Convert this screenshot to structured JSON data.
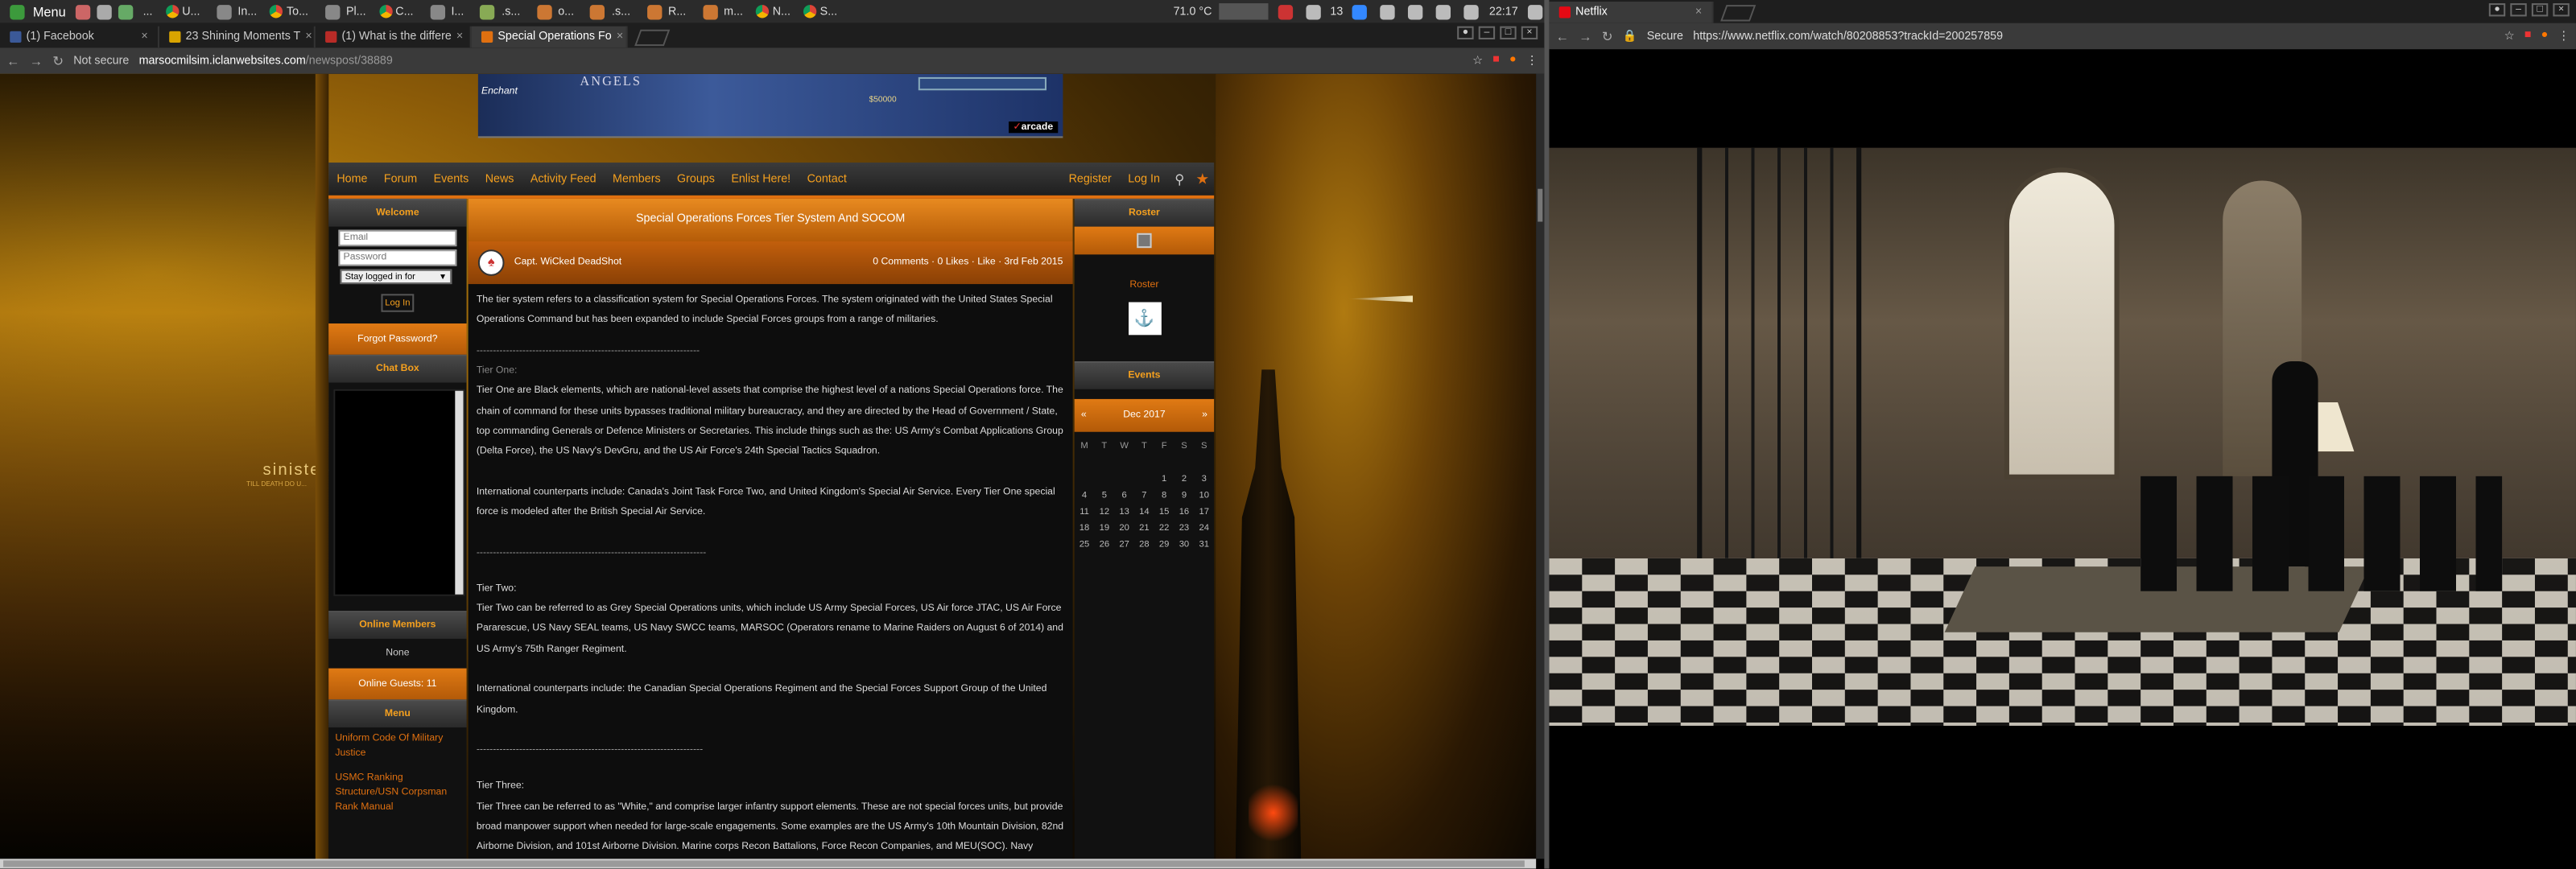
{
  "taskbar": {
    "menu_label": "Menu",
    "tasks": [
      {
        "label": "U..."
      },
      {
        "label": "In..."
      },
      {
        "label": "To..."
      },
      {
        "label": "Pl..."
      },
      {
        "label": "C..."
      },
      {
        "label": "I..."
      },
      {
        "label": ".s..."
      },
      {
        "label": "o..."
      },
      {
        "label": ".s..."
      },
      {
        "label": "R..."
      },
      {
        "label": "m..."
      },
      {
        "label": "N..."
      },
      {
        "label": "S..."
      }
    ],
    "temperature": "71.0 °C",
    "tray_count": "13",
    "clock": "22:17"
  },
  "left_browser": {
    "tabs": [
      {
        "title": "(1) Facebook",
        "color": "#3b5998"
      },
      {
        "title": "23 Shining Moments T",
        "color": "#d9a400"
      },
      {
        "title": "(1) What is the differe",
        "color": "#b92b27"
      },
      {
        "title": "Special Operations Fo",
        "color": "#e07010"
      }
    ],
    "security_label": "Not secure",
    "url_host": "marsocmilsim.iclanwebsites.com",
    "url_path": "/newspost/38889"
  },
  "site": {
    "ad": {
      "title": "ANGELS",
      "subtitle": "Enchant",
      "price": "$50000",
      "brand_prefix": "✓",
      "brand": "arcade"
    },
    "nav": [
      "Home",
      "Forum",
      "Events",
      "News",
      "Activity Feed",
      "Members",
      "Groups",
      "Enlist Here!",
      "Contact"
    ],
    "register": "Register",
    "login": "Log In",
    "branding": "sinisterd",
    "branding_sub": "TILL DEATH DO U...",
    "left": {
      "welcome": "Welcome",
      "email_placeholder": "Email",
      "password_placeholder": "Password",
      "stay_logged": "Stay logged in for",
      "login_button": "Log In",
      "forgot": "Forgot Password?",
      "chatbox": "Chat Box",
      "online_members": "Online Members",
      "none": "None",
      "online_guests": "Online Guests: 11",
      "menu": "Menu",
      "menu_items": [
        "Uniform Code Of Military Justice",
        "USMC Ranking Structure/USN Corpsman Rank Manual"
      ]
    },
    "post": {
      "title": "Special Operations Forces Tier System And SOCOM",
      "author": "Capt. WiCked DeadShot",
      "stats": "0 Comments · 0 Likes · Like · 3rd Feb 2015",
      "intro": "The tier system refers to a classification system for Special Operations Forces. The system originated with the United States Special Operations Command but has been expanded to include Special Forces groups from a range of militaries.",
      "rule1": "--------------------------------------------------------------------",
      "tier1_heading": "Tier One:",
      "tier1_text": "Tier One are Black elements, which are national-level assets that comprise the highest level of a nations Special Operations force. The chain of command for these units bypasses traditional military bureaucracy, and they are directed by the Head of Government / State, top commanding Generals or Defence Ministers or Secretaries. This include things such as the: US Army's Combat Applications Group (Delta Force), the US Navy's DevGru, and the US Air Force's 24th Special Tactics Squadron.",
      "tier1_intl": "International counterparts include: Canada's Joint Task Force Two, and United Kingdom's Special Air Service. Every Tier One special force is modeled after the British Special Air Service.",
      "rule2": "----------------------------------------------------------------------",
      "tier2_heading": "Tier Two:",
      "tier2_text": "Tier Two can be referred to as Grey Special Operations units, which include US Army Special Forces, US Air force JTAC, US Air Force Pararescue, US Navy SEAL teams, US Navy SWCC teams, MARSOC (Operators rename to Marine Raiders on August 6 of 2014) and US Army's 75th Ranger Regiment.",
      "tier2_intl": "International counterparts include: the Canadian Special Operations Regiment and the Special Forces Support Group of the United Kingdom.",
      "rule3": "---------------------------------------------------------------------",
      "tier3_heading": "Tier Three:",
      "tier3_text": "Tier Three can be referred to as \"White,\" and comprise larger infantry support elements. These are not special forces units, but provide broad manpower support when needed for large-scale engagements. Some examples are the US Army's 10th Mountain Division, 82nd Airborne Division, and 101st Airborne Division. Marine corps Recon Battalions, Force Recon Companies, and MEU(SOC). Navy"
    },
    "right": {
      "roster": "Roster",
      "roster_label": "Roster",
      "events": "Events",
      "month": "Dec 2017",
      "prev": "«",
      "next": "»",
      "weekdays": [
        "M",
        "T",
        "W",
        "T",
        "F",
        "S",
        "S"
      ],
      "weeks": [
        [
          "",
          "",
          "",
          "",
          "1",
          "2",
          "3"
        ],
        [
          "4",
          "5",
          "6",
          "7",
          "8",
          "9",
          "10"
        ],
        [
          "11",
          "12",
          "13",
          "14",
          "15",
          "16",
          "17"
        ],
        [
          "18",
          "19",
          "20",
          "21",
          "22",
          "23",
          "24"
        ],
        [
          "25",
          "26",
          "27",
          "28",
          "29",
          "30",
          "31"
        ]
      ]
    }
  },
  "right_browser": {
    "tab_title": "Netflix",
    "security_label": "Secure",
    "url": "https://www.netflix.com/watch/80208853?trackId=200257859"
  }
}
